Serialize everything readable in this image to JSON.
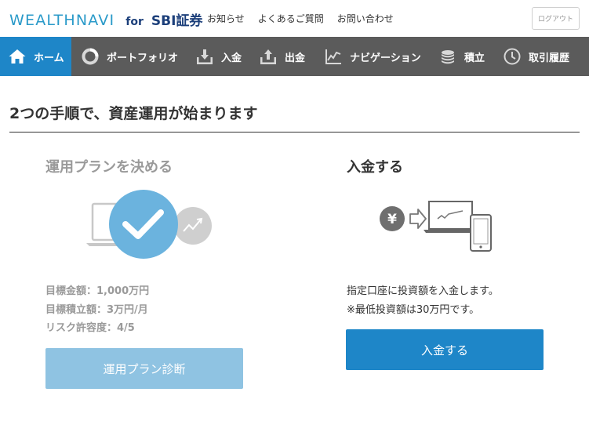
{
  "header": {
    "logo_main": "WEALTHNAVI",
    "logo_for": "for",
    "logo_sbi": "SBI証券",
    "links": [
      "お知らせ",
      "よくあるご質問",
      "お問い合わせ"
    ],
    "logout_label": "ログアウト"
  },
  "nav": {
    "items": [
      {
        "label": "ホーム",
        "icon": "home-icon",
        "active": true
      },
      {
        "label": "ポートフォリオ",
        "icon": "portfolio-ring-icon",
        "active": false
      },
      {
        "label": "入金",
        "icon": "deposit-icon",
        "active": false
      },
      {
        "label": "出金",
        "icon": "withdraw-icon",
        "active": false
      },
      {
        "label": "ナビゲーション",
        "icon": "chart-line-icon",
        "active": false
      },
      {
        "label": "積立",
        "icon": "coins-stack-icon",
        "active": false
      },
      {
        "label": "取引履歴",
        "icon": "clock-icon",
        "active": false
      }
    ],
    "active_color": "#1e86c8",
    "bg_color": "#5b5b5b"
  },
  "main": {
    "title": "2つの手順で、資産運用が始まります",
    "step1": {
      "title": "運用プランを決める",
      "info": [
        "目標金額：1,000万円",
        "目標積立額：3万円/月",
        "リスク許容度：4/5"
      ],
      "button_label": "運用プラン診断",
      "check_color": "#6bb3de"
    },
    "step2": {
      "title": "入金する",
      "info": [
        "指定口座に投資額を入金します。",
        "※最低投資額は30万円です。"
      ],
      "button_label": "入金する",
      "yen_symbol": "¥"
    }
  }
}
